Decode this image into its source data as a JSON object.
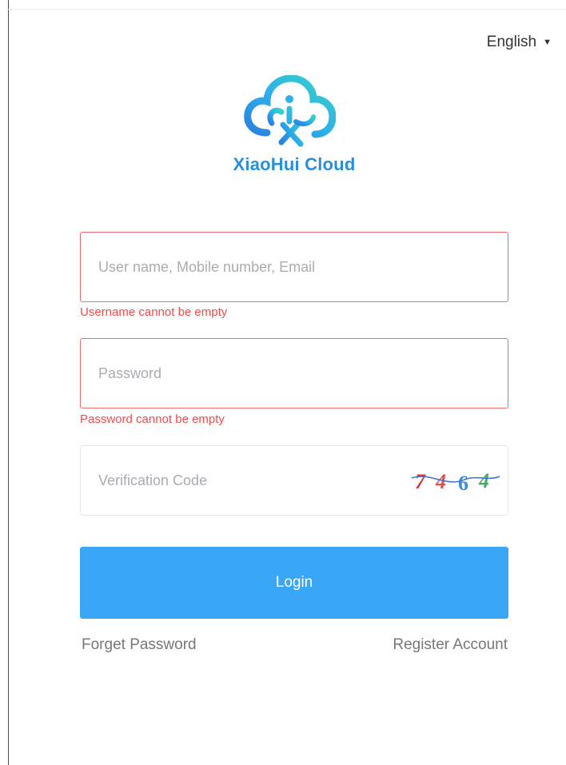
{
  "header": {
    "language_label": "English"
  },
  "brand": {
    "name": "XiaoHui Cloud",
    "color": "#2a8fd6"
  },
  "form": {
    "username": {
      "value": "",
      "placeholder": "User name, Mobile number, Email",
      "error": "Username cannot be empty"
    },
    "password": {
      "value": "",
      "placeholder": "Password",
      "error": "Password cannot be empty"
    },
    "verification": {
      "value": "",
      "placeholder": "Verification Code",
      "captcha_digits": [
        "7",
        "4",
        "6",
        "4"
      ]
    },
    "login_label": "Login",
    "forget_label": "Forget Password",
    "register_label": "Register Account"
  },
  "colors": {
    "error": "#f04b4b",
    "error_border": "#f36c6c",
    "primary": "#3aa6f6",
    "captcha": [
      "#d73636",
      "#e05050",
      "#3a8fd8",
      "#4aa86a"
    ]
  }
}
